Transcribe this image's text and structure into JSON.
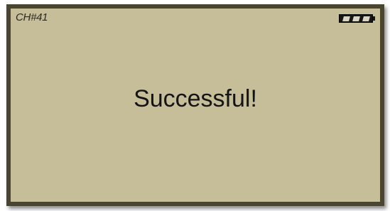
{
  "screen": {
    "channel_label": "CH#41",
    "message": "Successful!",
    "battery": {
      "icon": "battery-icon",
      "level_segments_filled": 3,
      "level_segments_total": 3
    }
  }
}
